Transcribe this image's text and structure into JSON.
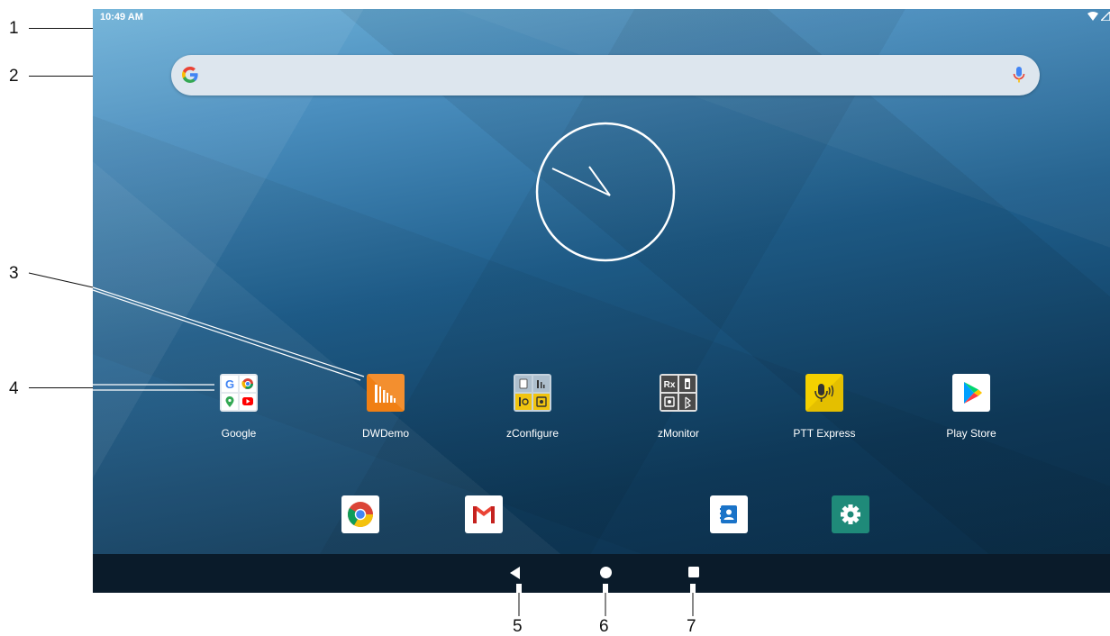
{
  "callouts": [
    "1",
    "2",
    "3",
    "4",
    "5",
    "6",
    "7"
  ],
  "status_bar": {
    "time": "10:49 AM",
    "icons": [
      "wifi-icon",
      "signal-icon"
    ]
  },
  "search": {
    "logo": "google-g-icon",
    "voice": "mic-icon"
  },
  "clock": {
    "type": "analog"
  },
  "apps": [
    {
      "label": "Google",
      "icon": "google-folder-icon"
    },
    {
      "label": "DWDemo",
      "icon": "dwdemo-icon"
    },
    {
      "label": "zConfigure",
      "icon": "zconfigure-icon"
    },
    {
      "label": "zMonitor",
      "icon": "zmonitor-icon"
    },
    {
      "label": "PTT Express",
      "icon": "ptt-express-icon"
    },
    {
      "label": "Play Store",
      "icon": "play-store-icon"
    }
  ],
  "dock": [
    "chrome-icon",
    "gmail-icon",
    "contacts-icon",
    "settings-icon"
  ],
  "nav": [
    "back-icon",
    "home-icon",
    "recents-icon"
  ],
  "colors": {
    "dwdemo": "#f07f14",
    "ptt": "#f4d000",
    "settings": "#1f8a79",
    "contacts": "#1a73c8"
  }
}
